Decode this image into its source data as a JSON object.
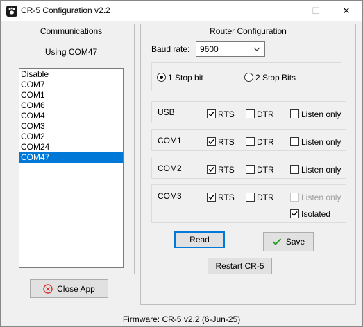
{
  "window": {
    "title": "CR-5 Configuration v2.2",
    "minimize": "—",
    "maximize": "☐",
    "close": "✕"
  },
  "communications": {
    "heading": "Communications",
    "status": "Using COM47",
    "ports": [
      "Disable",
      "COM7",
      "COM1",
      "COM6",
      "COM4",
      "COM3",
      "COM2",
      "COM24",
      "COM47"
    ],
    "selected": "COM47",
    "close_app": "Close App"
  },
  "router": {
    "heading": "Router Configuration",
    "baud_label": "Baud rate:",
    "baud_value": "9600",
    "stop_bits": [
      {
        "label": "1 Stop bit",
        "checked": true
      },
      {
        "label": "2 Stop Bits",
        "checked": false
      }
    ],
    "ports": [
      {
        "name": "USB",
        "rts": true,
        "dtr": false,
        "listen": false
      },
      {
        "name": "COM1",
        "rts": true,
        "dtr": false,
        "listen": false
      },
      {
        "name": "COM2",
        "rts": true,
        "dtr": false,
        "listen": false
      },
      {
        "name": "COM3",
        "rts": true,
        "dtr": false,
        "listen": false,
        "listen_disabled": true,
        "isolated": true
      }
    ],
    "rts_label": "RTS",
    "dtr_label": "DTR",
    "listen_label": "Listen only",
    "isolated_label": "Isolated",
    "read_button": "Read",
    "save_button": "Save",
    "restart_button": "Restart CR-5"
  },
  "status": {
    "firmware": "Firmware: CR-5 v2.2 (6-Jun-25)"
  },
  "colors": {
    "selection": "#0078d7",
    "accent_border": "#0078d7",
    "close_icon": "#d9302c",
    "save_check": "#2aa12a"
  },
  "icons": {
    "app": "paw-icon",
    "close_app": "x-circle-icon",
    "save": "checkmark-icon",
    "combo": "chevron-down-icon"
  }
}
